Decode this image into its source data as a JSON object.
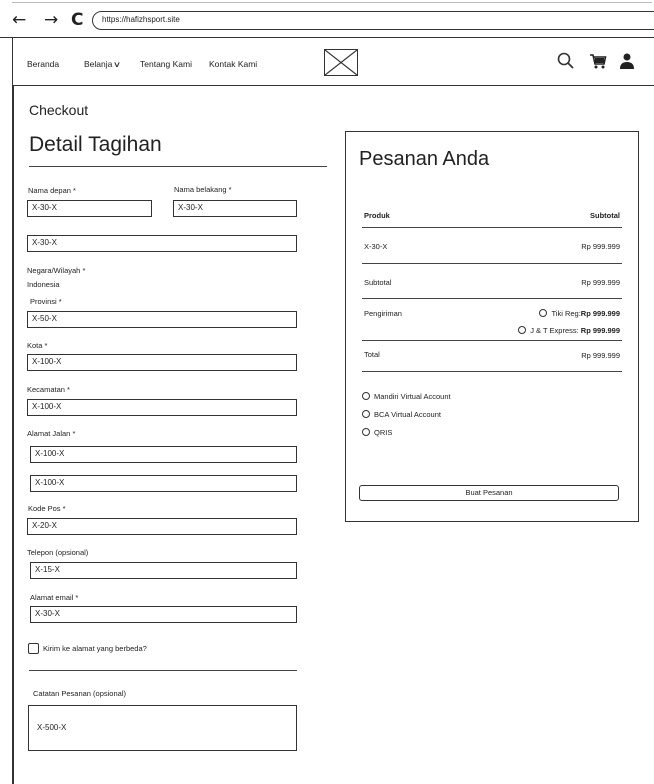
{
  "browser": {
    "back": "←",
    "forward": "→",
    "reload": "C",
    "url": "https://hafizhsport.site"
  },
  "nav": {
    "beranda": "Beranda",
    "belanja": "Belanja",
    "tentang": "Tentang Kami",
    "kontak": "Kontak Kami",
    "icons": [
      "search-icon",
      "cart-icon",
      "user-icon"
    ]
  },
  "checkout": {
    "title": "Checkout",
    "billing_title": "Detail Tagihan",
    "first_name_label": "Nama depan *",
    "first_name_value": "X-30-X",
    "last_name_label": "Nama belakang *",
    "last_name_value": "X-30-X",
    "company_value": "X-30-X",
    "country_label": "Negara/Wilayah *",
    "country_value": "Indonesia",
    "province_label": "Provinsi *",
    "province_value": "X-50-X",
    "city_label": "Kota *",
    "city_value": "X-100-X",
    "district_label": "Kecamatan *",
    "district_value": "X-100-X",
    "street_label": "Alamat Jalan *",
    "street_value": "X-100-X",
    "street2_value": "X-100-X",
    "postcode_label": "Kode Pos *",
    "postcode_value": "X-20-X",
    "phone_label": "Telepon (opsional)",
    "phone_value": "X-15-X",
    "email_label": "Alamat email *",
    "email_value": "X-30-X",
    "ship_different_label": "Kirim ke alamat yang berbeda?",
    "notes_label": "Catatan Pesanan (opsional)",
    "notes_value": "X-500-X"
  },
  "order": {
    "title": "Pesanan Anda",
    "col_product": "Produk",
    "col_subtotal": "Subtotal",
    "product_name": "X-30-X",
    "product_price": "Rp 999.999",
    "subtotal_label": "Subtotal",
    "subtotal_value": "Rp 999.999",
    "shipping_label": "Pengiriman",
    "shipping_option_1_label": "Tiki Reg:",
    "shipping_option_1_price": "Rp 999.999",
    "shipping_option_2_label": "J & T Express:",
    "shipping_option_2_price": "Rp 999.999",
    "total_label": "Total",
    "total_value": "Rp 999.999",
    "payment_methods": [
      "Mandiri Virtual Account",
      "BCA Virtual Account",
      "QRIS"
    ],
    "place_order": "Buat Pesanan"
  }
}
